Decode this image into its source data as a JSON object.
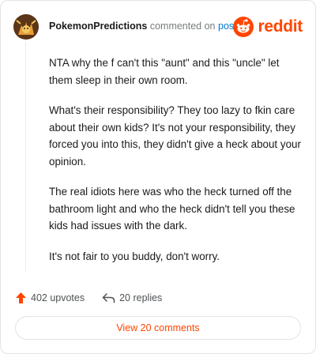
{
  "header": {
    "username": "PokemonPredictions",
    "commented_on": "commented on",
    "post_link": "post",
    "brand": "reddit"
  },
  "comment": {
    "paragraphs": [
      "NTA why the f can't this \"aunt\" and this \"uncle\" let them sleep in their own room.",
      "What's their responsibility? They too lazy to fkin care about their own kids? It's not your responsibility, they forced you into this, they didn't give a heck about your opinion.",
      "The real idiots here was who the heck turned off the bathroom light and who the heck didn't tell you these kids had issues with the dark.",
      "It's not fair to you buddy, don't worry."
    ]
  },
  "stats": {
    "upvotes": "402 upvotes",
    "replies": "20 replies"
  },
  "actions": {
    "view_comments": "View 20 comments"
  },
  "colors": {
    "brand": "#ff4500",
    "link": "#0079d3",
    "upvote": "#ff4500"
  }
}
